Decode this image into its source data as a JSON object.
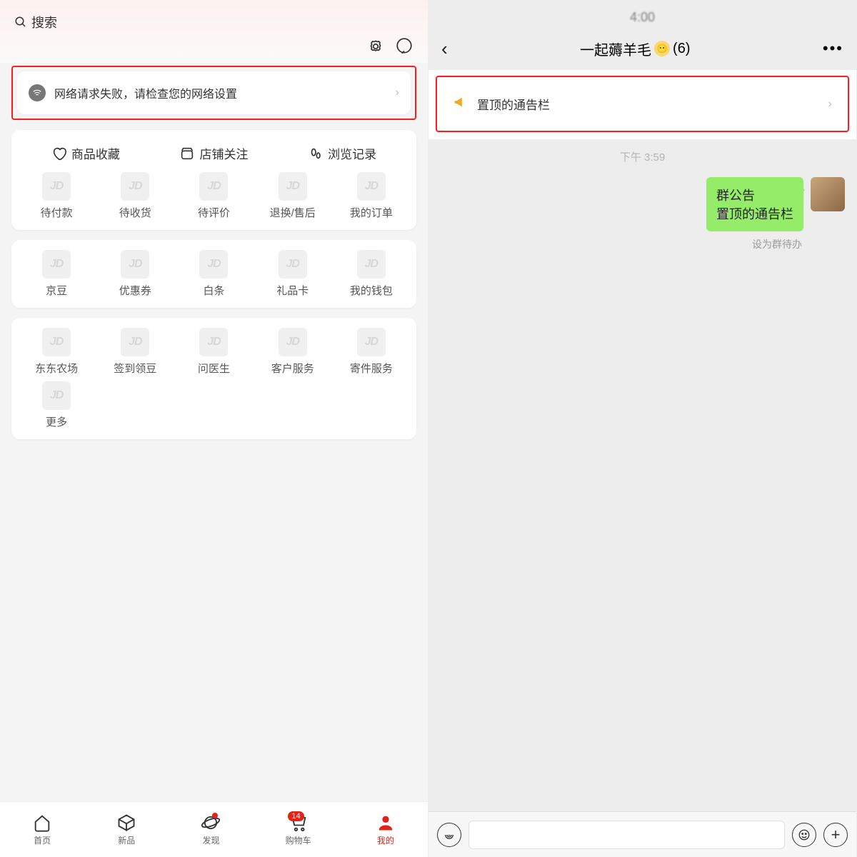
{
  "left": {
    "search_label": "搜索",
    "notice_text": "网络请求失败，请检查您的网络设置",
    "tabs": [
      {
        "label": "商品收藏"
      },
      {
        "label": "店铺关注"
      },
      {
        "label": "浏览记录"
      }
    ],
    "orders": [
      {
        "label": "待付款"
      },
      {
        "label": "待收货"
      },
      {
        "label": "待评价"
      },
      {
        "label": "退换/售后"
      },
      {
        "label": "我的订单"
      }
    ],
    "wallet": [
      {
        "label": "京豆"
      },
      {
        "label": "优惠券"
      },
      {
        "label": "白条"
      },
      {
        "label": "礼品卡"
      },
      {
        "label": "我的钱包"
      }
    ],
    "services": [
      {
        "label": "东东农场"
      },
      {
        "label": "签到领豆"
      },
      {
        "label": "问医生"
      },
      {
        "label": "客户服务"
      },
      {
        "label": "寄件服务"
      },
      {
        "label": "更多"
      }
    ],
    "jd_placeholder": "JD",
    "bottom": {
      "home": "首页",
      "new": "新品",
      "discover": "发现",
      "cart": "购物车",
      "cart_badge": "14",
      "mine": "我的"
    }
  },
  "right": {
    "clock_blur": "4:00",
    "title_prefix": "一起薅羊毛",
    "title_count": "(6)",
    "pinned_text": "置顶的通告栏",
    "time_label": "下午 3:59",
    "msg_line1": "群公告",
    "msg_line2": "置顶的通告栏",
    "todo_label": "设为群待办"
  }
}
